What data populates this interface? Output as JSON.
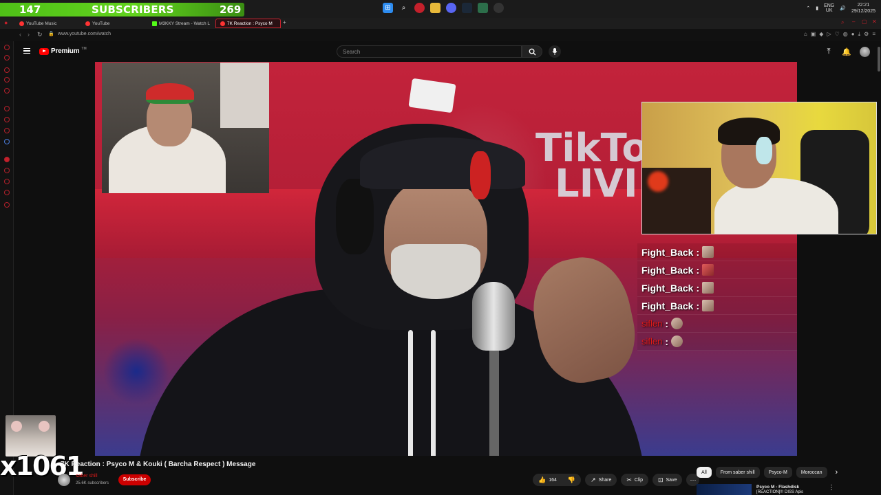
{
  "overlay": {
    "sub_count": "147",
    "sub_label": "SUBSCRIBERS",
    "sub_goal": "269",
    "combo_text": "x1061"
  },
  "taskbar": {
    "lang_top": "ENG",
    "lang_bottom": "UK",
    "time": "22:21",
    "date": "29/12/2025"
  },
  "tabs": [
    {
      "label": "YouTube Music",
      "color": "#ff3333"
    },
    {
      "label": "YouTube",
      "color": "#ff3333"
    },
    {
      "label": "M3KKY Stream - Watch L",
      "color": "#53fc18"
    },
    {
      "label": "7K Reaction : Psyco M",
      "color": "#ff3333"
    }
  ],
  "browser": {
    "url": "www.youtube.com/watch"
  },
  "youtube": {
    "logo_text": "Premium",
    "tm": "TM",
    "search_placeholder": "Search"
  },
  "video": {
    "stream_text_line1": "TikTo",
    "stream_text_line2": "LIVI",
    "title": "7K Reaction : Psyco M & Kouki ( Barcha Respect ) Message",
    "channel_name": "saber shill",
    "subscribers": "25.6K subscribers",
    "subscribe_label": "Subscribe",
    "likes": "164",
    "share_label": "Share",
    "clip_label": "Clip",
    "save_label": "Save"
  },
  "chat": [
    {
      "user": "Fight_Back",
      "color": "#ffffff"
    },
    {
      "user": "Fight_Back",
      "color": "#ffffff"
    },
    {
      "user": "Fight_Back",
      "color": "#ffffff"
    },
    {
      "user": "Fight_Back",
      "color": "#ffffff"
    },
    {
      "user": "siflen",
      "color": "#e01a1a"
    },
    {
      "user": "siflen",
      "color": "#e01a1a"
    }
  ],
  "chips": [
    "All",
    "From saber shill",
    "Psyco-M",
    "Moroccan"
  ],
  "recommendation": {
    "title": "Psyco M - Flashdisk",
    "subtitle": "[REACTION]!!! DISS Apis"
  },
  "colors": {
    "accent": "#ff0000",
    "subscribe_bg": "#cc0000",
    "sub_bar": "#53c019"
  }
}
